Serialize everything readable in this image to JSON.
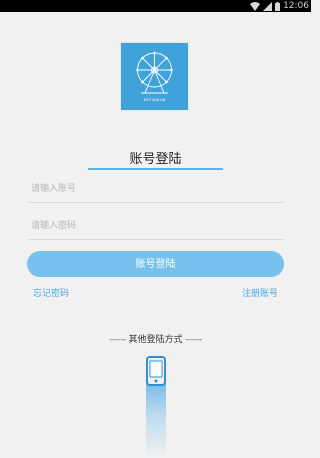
{
  "status_bar": {
    "time": "12:06"
  },
  "logo": {
    "caption": "MOTIANLUN",
    "icon": "ferris-wheel-icon"
  },
  "login": {
    "title": "账号登陆",
    "account_placeholder": "请输入账号",
    "password_placeholder": "请输入密码",
    "button_label": "账号登陆",
    "forgot_label": "忘记密码",
    "register_label": "注册账号"
  },
  "other_login": {
    "dashes_left": "------",
    "label": "其他登陆方式",
    "dashes_right": "------",
    "icon": "phone-icon"
  },
  "colors": {
    "accent": "#78c0ee",
    "link": "#4aa7e2",
    "logo_bg": "#3fa2d8",
    "background": "#f1f1f1"
  }
}
